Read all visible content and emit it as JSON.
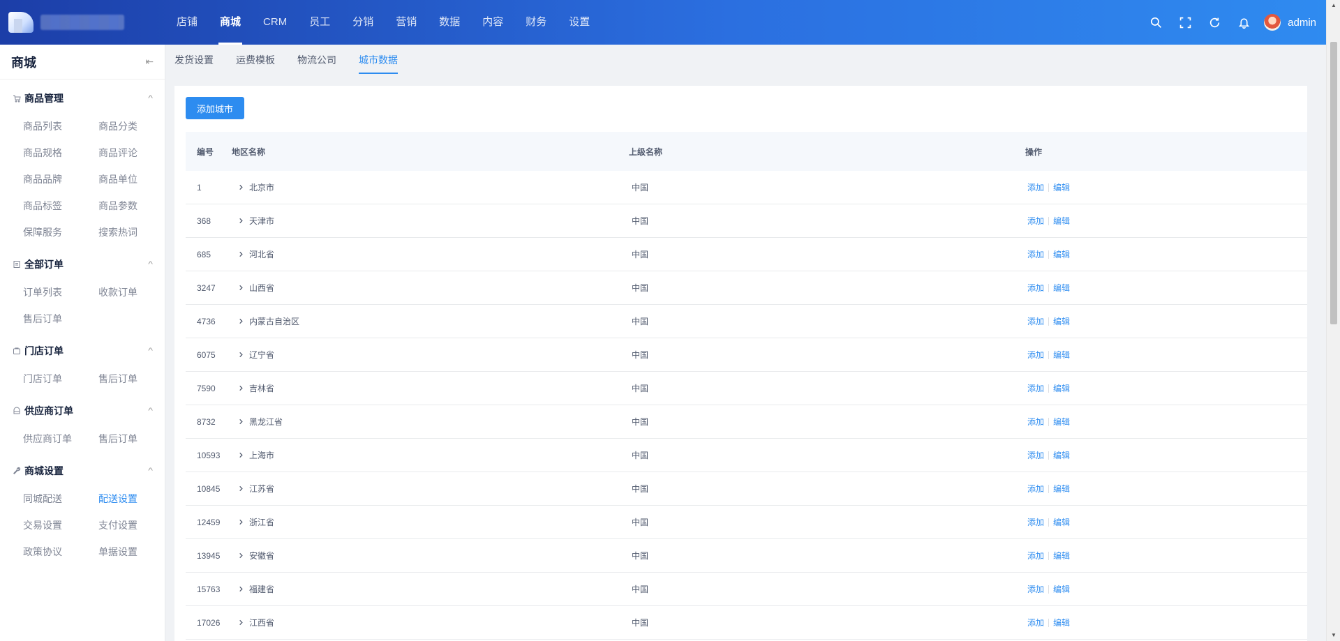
{
  "header": {
    "nav": [
      "店铺",
      "商城",
      "CRM",
      "员工",
      "分销",
      "营销",
      "数据",
      "内容",
      "财务",
      "设置"
    ],
    "active_nav": "商城",
    "username": "admin"
  },
  "sidebar": {
    "title": "商城",
    "groups": [
      {
        "label": "商品管理",
        "icon": "cart-icon",
        "items": [
          "商品列表",
          "商品分类",
          "商品规格",
          "商品评论",
          "商品品牌",
          "商品单位",
          "商品标签",
          "商品参数",
          "保障服务",
          "搜索热词"
        ]
      },
      {
        "label": "全部订单",
        "icon": "order-icon",
        "items": [
          "订单列表",
          "收款订单",
          "售后订单"
        ]
      },
      {
        "label": "门店订单",
        "icon": "store-icon",
        "items": [
          "门店订单",
          "售后订单"
        ]
      },
      {
        "label": "供应商订单",
        "icon": "supplier-icon",
        "items": [
          "供应商订单",
          "售后订单"
        ]
      },
      {
        "label": "商城设置",
        "icon": "wrench-icon",
        "items": [
          "同城配送",
          "配送设置",
          "交易设置",
          "支付设置",
          "政策协议",
          "单据设置"
        ]
      }
    ],
    "active_item": "配送设置"
  },
  "tabs": [
    "发货设置",
    "运费模板",
    "物流公司",
    "城市数据"
  ],
  "active_tab": "城市数据",
  "add_button": "添加城市",
  "table": {
    "headers": [
      "编号",
      "地区名称",
      "上级名称",
      "操作"
    ],
    "op_add": "添加",
    "op_edit": "编辑",
    "rows": [
      {
        "id": "1",
        "name": "北京市",
        "parent": "中国"
      },
      {
        "id": "368",
        "name": "天津市",
        "parent": "中国"
      },
      {
        "id": "685",
        "name": "河北省",
        "parent": "中国"
      },
      {
        "id": "3247",
        "name": "山西省",
        "parent": "中国"
      },
      {
        "id": "4736",
        "name": "内蒙古自治区",
        "parent": "中国"
      },
      {
        "id": "6075",
        "name": "辽宁省",
        "parent": "中国"
      },
      {
        "id": "7590",
        "name": "吉林省",
        "parent": "中国"
      },
      {
        "id": "8732",
        "name": "黑龙江省",
        "parent": "中国"
      },
      {
        "id": "10593",
        "name": "上海市",
        "parent": "中国"
      },
      {
        "id": "10845",
        "name": "江苏省",
        "parent": "中国"
      },
      {
        "id": "12459",
        "name": "浙江省",
        "parent": "中国"
      },
      {
        "id": "13945",
        "name": "安徽省",
        "parent": "中国"
      },
      {
        "id": "15763",
        "name": "福建省",
        "parent": "中国"
      },
      {
        "id": "17026",
        "name": "江西省",
        "parent": "中国"
      }
    ]
  }
}
